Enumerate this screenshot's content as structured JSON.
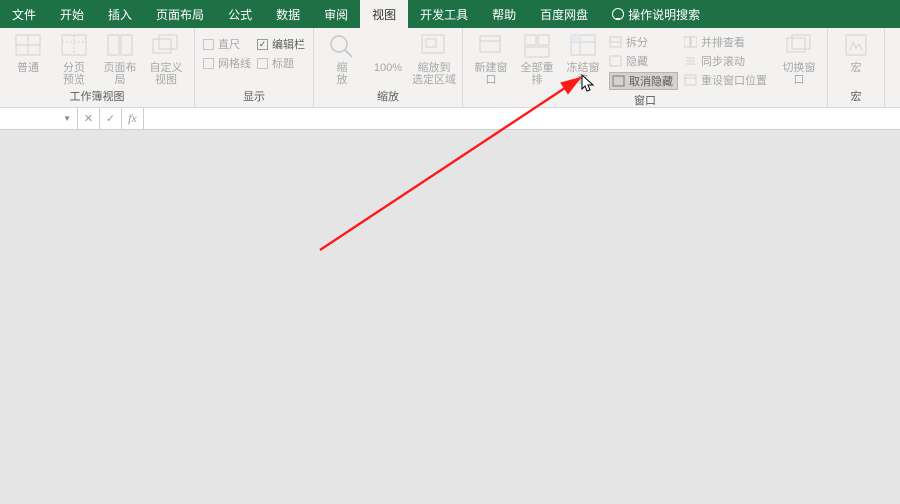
{
  "menu": {
    "file": "文件",
    "home": "开始",
    "insert": "插入",
    "layout": "页面布局",
    "formula": "公式",
    "data": "数据",
    "review": "审阅",
    "view": "视图",
    "dev": "开发工具",
    "help": "帮助",
    "baidu": "百度网盘",
    "search": "操作说明搜索"
  },
  "ribbon": {
    "workbookViews": {
      "normal": "普通",
      "pageBreak": "分页\n预览",
      "pageLayout": "页面布局",
      "custom": "自定义视图",
      "group": "工作簿视图"
    },
    "show": {
      "ruler": "直尺",
      "editBar": "编辑栏",
      "grid": "网格线",
      "headings": "标题",
      "group": "显示"
    },
    "zoom": {
      "zoom": "缩\n放",
      "p100": "100%",
      "toSel": "缩放到\n选定区域",
      "group": "缩放"
    },
    "window": {
      "neww": "新建窗口",
      "arrange": "全部重排",
      "freeze": "冻结窗格",
      "split": "拆分",
      "hide": "隐藏",
      "unhide": "取消隐藏",
      "sideBySide": "并排查看",
      "syncScroll": "同步滚动",
      "reset": "重设窗口位置",
      "switch": "切换窗口",
      "group": "窗口"
    },
    "macro": {
      "macros": "宏",
      "group": "宏"
    }
  },
  "fx": {
    "fxLabel": "fx"
  }
}
